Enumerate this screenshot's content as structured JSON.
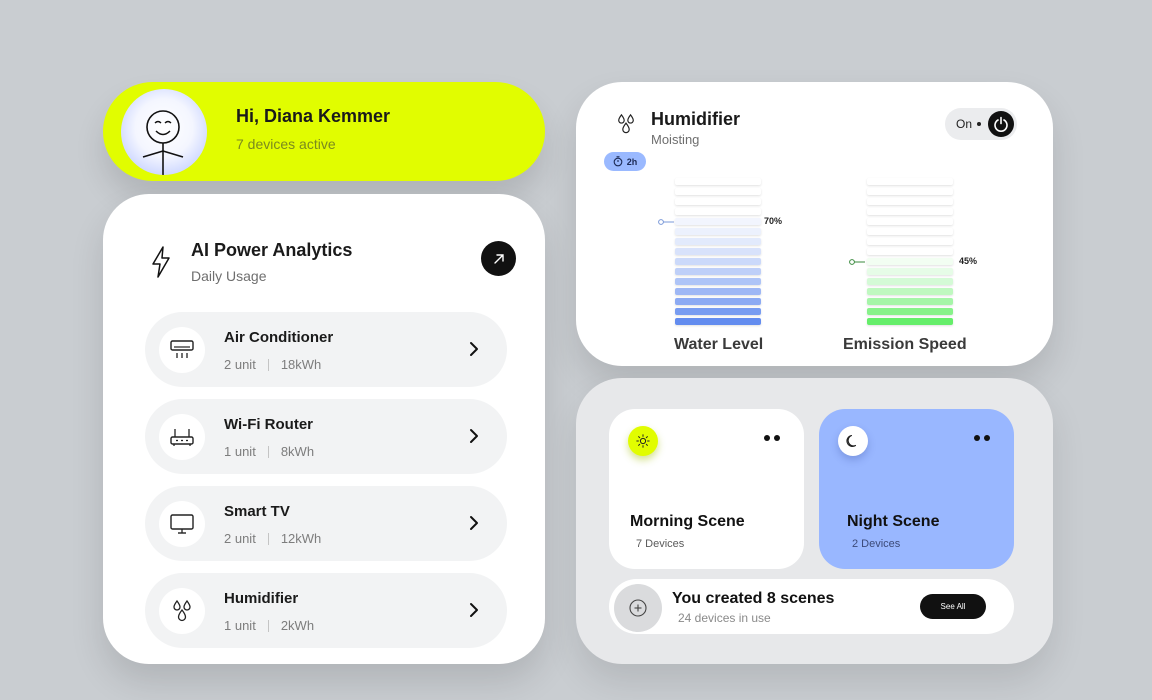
{
  "profile": {
    "greeting": "Hi, Diana Kemmer",
    "status": "7 devices active",
    "avatar_icon": "smiley-stick-figure"
  },
  "analytics": {
    "title": "AI Power Analytics",
    "subtitle": "Daily Usage",
    "title_icon": "bolt-icon",
    "open_icon": "arrow-up-right-icon",
    "devices": [
      {
        "name": "Air Conditioner",
        "units": "2 unit",
        "usage": "18kWh",
        "icon": "air-conditioner-icon"
      },
      {
        "name": "Wi-Fi Router",
        "units": "1 unit",
        "usage": "8kWh",
        "icon": "router-icon"
      },
      {
        "name": "Smart TV",
        "units": "2 unit",
        "usage": "12kWh",
        "icon": "tv-icon"
      },
      {
        "name": "Humidifier",
        "units": "1 unit",
        "usage": "2kWh",
        "icon": "droplets-icon"
      }
    ]
  },
  "humidifier": {
    "title": "Humidifier",
    "subtitle": "Moisting",
    "toggle_label": "On",
    "timer": "2h",
    "water_level": {
      "label": "Water Level",
      "percent_label": "70%",
      "percent": 70,
      "color": "#5b86ee"
    },
    "emission_speed": {
      "label": "Emission Speed",
      "percent_label": "45%",
      "percent": 45,
      "color": "#5ded62"
    }
  },
  "scenes": {
    "items": [
      {
        "name": "Morning Scene",
        "devices": "7 Devices",
        "icon": "sun-icon",
        "bg": "#ffffff",
        "icon_bg": "#e1fd00"
      },
      {
        "name": "Night Scene",
        "devices": "2 Devices",
        "icon": "moon-icon",
        "bg": "#99b7ff",
        "icon_bg": "#ffffff"
      }
    ],
    "summary_title": "You created 8 scenes",
    "summary_sub": "24 devices in use",
    "see_all": "See All"
  },
  "colors": {
    "accent_lime": "#e1fd00",
    "accent_blue": "#99b7ff",
    "water_blue": "#5b86ee",
    "emission_green": "#5ded62"
  }
}
